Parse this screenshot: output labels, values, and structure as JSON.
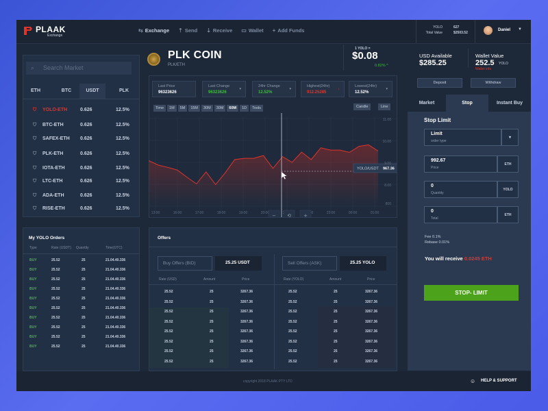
{
  "brand": {
    "name": "PLAAK",
    "sub": "Exchange"
  },
  "nav": [
    {
      "label": "Exchange",
      "icon": "exchange-icon"
    },
    {
      "label": "Send",
      "icon": "upload-icon"
    },
    {
      "label": "Receive",
      "icon": "download-icon"
    },
    {
      "label": "Wallet",
      "icon": "wallet-icon"
    },
    {
      "label": "Add Funds",
      "icon": "plus-icon"
    }
  ],
  "account": {
    "yolo_label": "YOLO",
    "yolo_value": "627",
    "total_label": "Total Value",
    "total_value": "$2503.52",
    "user": "Daniel"
  },
  "market": {
    "search_placeholder": "Search Market",
    "tabs": [
      "ETH",
      "BTC",
      "USDT",
      "PLK"
    ],
    "active_tab": "USDT",
    "rows": [
      {
        "pair": "YOLO-ETH",
        "price": "0.626",
        "change": "12.5%",
        "highlight": true
      },
      {
        "pair": "BTC-ETH",
        "price": "0.626",
        "change": "12.5%"
      },
      {
        "pair": "SAFEX-ETH",
        "price": "0.626",
        "change": "12.5%"
      },
      {
        "pair": "PLK-ETH",
        "price": "0.626",
        "change": "12.5%"
      },
      {
        "pair": "IOTA-ETH",
        "price": "0.626",
        "change": "12.5%"
      },
      {
        "pair": "LTC-ETH",
        "price": "0.626",
        "change": "12.5%"
      },
      {
        "pair": "ADA-ETH",
        "price": "0.626",
        "change": "12.5%"
      },
      {
        "pair": "RISE-ETH",
        "price": "0.626",
        "change": "12.5%"
      }
    ]
  },
  "coin": {
    "title": "PLK COIN",
    "pair": "PLK/ETH",
    "yolo_label": "1 YOLO =",
    "price": "$0.08",
    "change": "0.82% ^"
  },
  "stats": [
    {
      "label": "Last Price",
      "value": "96323626",
      "color": "#ffffff"
    },
    {
      "label": "Last Change",
      "value": "96323626",
      "color": "#3bbf36"
    },
    {
      "label": "24hr Change",
      "value": "12.52%",
      "color": "#3bbf36"
    },
    {
      "label": "Highest(24hr)",
      "value": "912.25285",
      "color": "#e0342a"
    },
    {
      "label": "Lowest(24hr)",
      "value": "12.52%",
      "color": "#ffffff"
    }
  ],
  "timeframes": [
    "Time",
    "1M",
    "5M",
    "15M",
    "30M",
    "30M",
    "60M",
    "1D",
    "Tools"
  ],
  "active_timeframe": "60M",
  "chart_buttons": [
    "Candle",
    "Line"
  ],
  "chart_data": {
    "type": "area",
    "x_ticks": [
      "13:00",
      "16:00",
      "17:00",
      "18:00",
      "19:00",
      "20:00",
      "21:00",
      "22:00",
      "23:00",
      "00:00",
      "01:00"
    ],
    "y_ticks": [
      "11.00",
      "10.00",
      "9.00",
      "8.00",
      "800"
    ],
    "ylim": [
      800,
      1150
    ],
    "tooltip": {
      "label": "YOLO/USDT",
      "value": "967.36"
    },
    "series": [
      {
        "values": [
          982,
          964,
          955,
          944,
          916,
          889,
          937,
          886,
          933,
          986,
          991,
          991,
          1002,
          951,
          998,
          975,
          1016,
          986,
          1033,
          1024,
          1024,
          1015,
          1039,
          1045,
          1020
        ]
      }
    ]
  },
  "chart_zoom": {
    "minus": "−",
    "reset": "⟲",
    "plus": "+"
  },
  "orders": {
    "title": "My YOLO Orders",
    "columns": [
      "Type",
      "Rate (USDT)",
      "Quantity",
      "Time(UTC)"
    ],
    "rows": [
      [
        "BUY",
        "25.52",
        "25",
        "21.04.40.336"
      ],
      [
        "BUY",
        "25.52",
        "25",
        "21.04.40.336"
      ],
      [
        "BUY",
        "25.52",
        "25",
        "21.04.40.336"
      ],
      [
        "BUY",
        "25.52",
        "25",
        "21.04.40.336"
      ],
      [
        "BUY",
        "25.52",
        "25",
        "21.04.40.336"
      ],
      [
        "BUY",
        "25.52",
        "25",
        "21.04.40.336"
      ],
      [
        "BUY",
        "25.52",
        "25",
        "21.04.40.336"
      ],
      [
        "BUY",
        "25.52",
        "25",
        "21.04.40.336"
      ],
      [
        "BUY",
        "25.52",
        "25",
        "21.04.40.336"
      ],
      [
        "BUY",
        "25.52",
        "25",
        "21.04.40.336"
      ]
    ]
  },
  "offers": {
    "title": "Offers",
    "buy_label": "Buy Offers (BID)",
    "buy_value": "25.25 USDT",
    "sell_label": "Sell Offers (ASK)",
    "sell_value": "25.25 YOLO",
    "buy_columns": [
      "Rate (USD)",
      "Amount",
      "Price"
    ],
    "sell_columns": [
      "Rate (YOLO)",
      "Amount",
      "Price"
    ],
    "rows": [
      [
        "25.52",
        "25",
        "3267.36"
      ],
      [
        "25.52",
        "25",
        "3267.36"
      ],
      [
        "25.52",
        "25",
        "3267.36"
      ],
      [
        "25.52",
        "25",
        "3267.36"
      ],
      [
        "25.52",
        "25",
        "3267.36"
      ],
      [
        "25.52",
        "25",
        "3267.36"
      ],
      [
        "25.52",
        "25",
        "3267.36"
      ],
      [
        "25.52",
        "25",
        "3267.36"
      ]
    ]
  },
  "balances": {
    "usd_label": "USD Available",
    "usd_value": "$285.25",
    "wallet_label": "Wallet Value",
    "wallet_value": "252.5",
    "wallet_unit": "YOLO",
    "wallet_info": "Wallet info",
    "deposit": "Deposit",
    "withdraw": "Withdraw"
  },
  "trade_tabs": [
    "Market",
    "Stop",
    "Instant Buy"
  ],
  "active_trade_tab": "Stop",
  "stop_limit": {
    "title": "Stop Limit",
    "order_type": "Limit",
    "order_type_label": "order type",
    "price_value": "992.67",
    "price_label": "Price",
    "price_unit": "ETH",
    "qty_value": "0",
    "qty_label": "Quantity",
    "qty_unit": "YOLO",
    "total_value": "0",
    "total_label": "Total",
    "total_unit": "ETH",
    "fee": "Fee 0.1%",
    "rebate": "Rebase 0.01%",
    "receive_label": "You will receive",
    "receive_value": "0.0245 ETH",
    "button": "STOP- LIMIT"
  },
  "footer": {
    "copyright": "copyright 2018 PLAAK PTY LTD",
    "support": "HELP & SUPPORT"
  }
}
